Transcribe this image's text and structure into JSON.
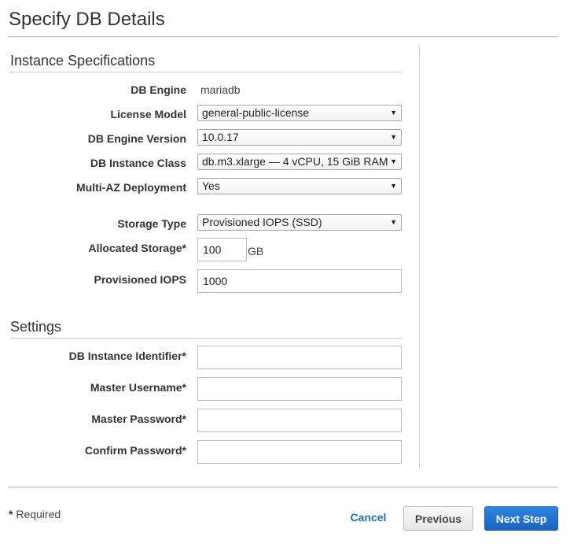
{
  "page": {
    "title": "Specify DB Details"
  },
  "instance_specifications": {
    "heading": "Instance Specifications",
    "db_engine": {
      "label": "DB Engine",
      "value": "mariadb"
    },
    "license_model": {
      "label": "License Model",
      "value": "general-public-license"
    },
    "db_engine_version": {
      "label": "DB Engine Version",
      "value": "10.0.17"
    },
    "db_instance_class": {
      "label": "DB Instance Class",
      "value": "db.m3.xlarge — 4 vCPU, 15 GiB RAM"
    },
    "multi_az_deployment": {
      "label": "Multi-AZ Deployment",
      "value": "Yes"
    },
    "storage_type": {
      "label": "Storage Type",
      "value": "Provisioned IOPS (SSD)"
    },
    "allocated_storage": {
      "label": "Allocated Storage*",
      "value": "100",
      "unit": "GB"
    },
    "provisioned_iops": {
      "label": "Provisioned IOPS",
      "value": "1000"
    }
  },
  "settings": {
    "heading": "Settings",
    "db_instance_identifier": {
      "label": "DB Instance Identifier*",
      "value": ""
    },
    "master_username": {
      "label": "Master Username*",
      "value": ""
    },
    "master_password": {
      "label": "Master Password*",
      "value": ""
    },
    "confirm_password": {
      "label": "Confirm Password*",
      "value": ""
    }
  },
  "footer": {
    "required_marker": "*",
    "required_text": " Required",
    "cancel_label": "Cancel",
    "previous_label": "Previous",
    "next_label": "Next Step"
  },
  "icons": {
    "dropdown_caret": "▼"
  },
  "colors": {
    "primary_button": "#1a63be",
    "link": "#1f6fae"
  }
}
